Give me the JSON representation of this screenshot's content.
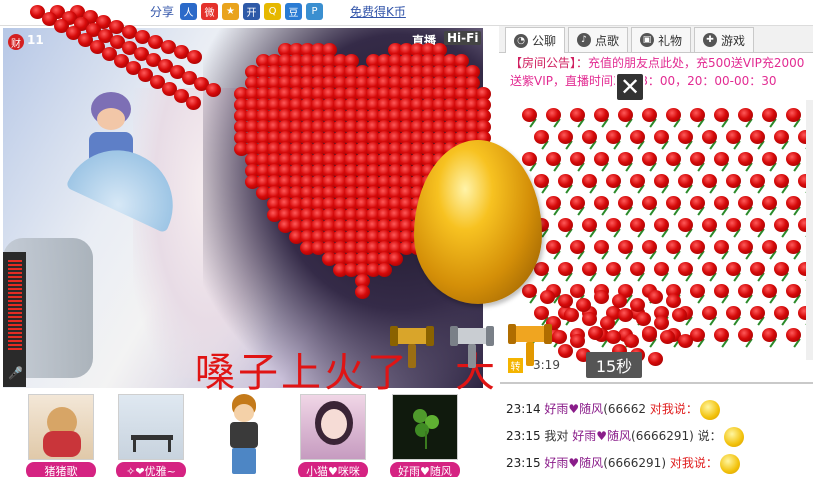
{
  "topbar": {
    "share_label": "分享",
    "free_coin_link": "免费得K币"
  },
  "video": {
    "badge": "财",
    "viewer_count": "11",
    "live_label": "直播",
    "quality": "Hi-Fi",
    "caption": "嗓子上火了",
    "caption_tail": "大"
  },
  "tabs": [
    {
      "label": "公聊",
      "icon": "chat-bubble-icon"
    },
    {
      "label": "点歌",
      "icon": "music-note-icon"
    },
    {
      "label": "礼物",
      "icon": "gift-icon"
    },
    {
      "label": "游戏",
      "icon": "gamepad-icon"
    }
  ],
  "notice": {
    "prefix": "【房间公告】：",
    "text": "充值的朋友点此处，充500送VIP充2000送紫VIP，直播时间",
    "hours": "30-18：00，20：00-00：30"
  },
  "gift_timer": "15秒",
  "partial_time": "3:19",
  "chat": [
    {
      "time": "23:14",
      "pre": "",
      "name": "好雨♥随风",
      "id": "(66662",
      "post": "",
      "to": "对我说：",
      "emoji": "laughing-smiley-icon"
    },
    {
      "time": "23:15",
      "pre": "我对",
      "name": "好雨♥随风",
      "id": "(6666291)",
      "post": " 说：",
      "to": "",
      "emoji": "grin-smiley-icon"
    },
    {
      "time": "23:15",
      "pre": "",
      "name": "好雨♥随风",
      "id": "(6666291)",
      "post": "",
      "to": "对我说：",
      "emoji": "wink-smiley-icon"
    }
  ],
  "audience": [
    {
      "name": "猪猪歌",
      "icon": "teddy-bear-avatar-icon"
    },
    {
      "name": "✧❤优雅~",
      "icon": "bench-avatar-icon"
    },
    {
      "name": "小猫♥咪咪",
      "icon": "girl-avatar-icon"
    },
    {
      "name": "好雨♥随风",
      "icon": "clover-avatar-icon"
    }
  ],
  "colors": {
    "accent_pink": "#d52382",
    "notice_pink": "#e22b92",
    "rose_red": "#d60a0a",
    "caption_red": "#e01414"
  }
}
